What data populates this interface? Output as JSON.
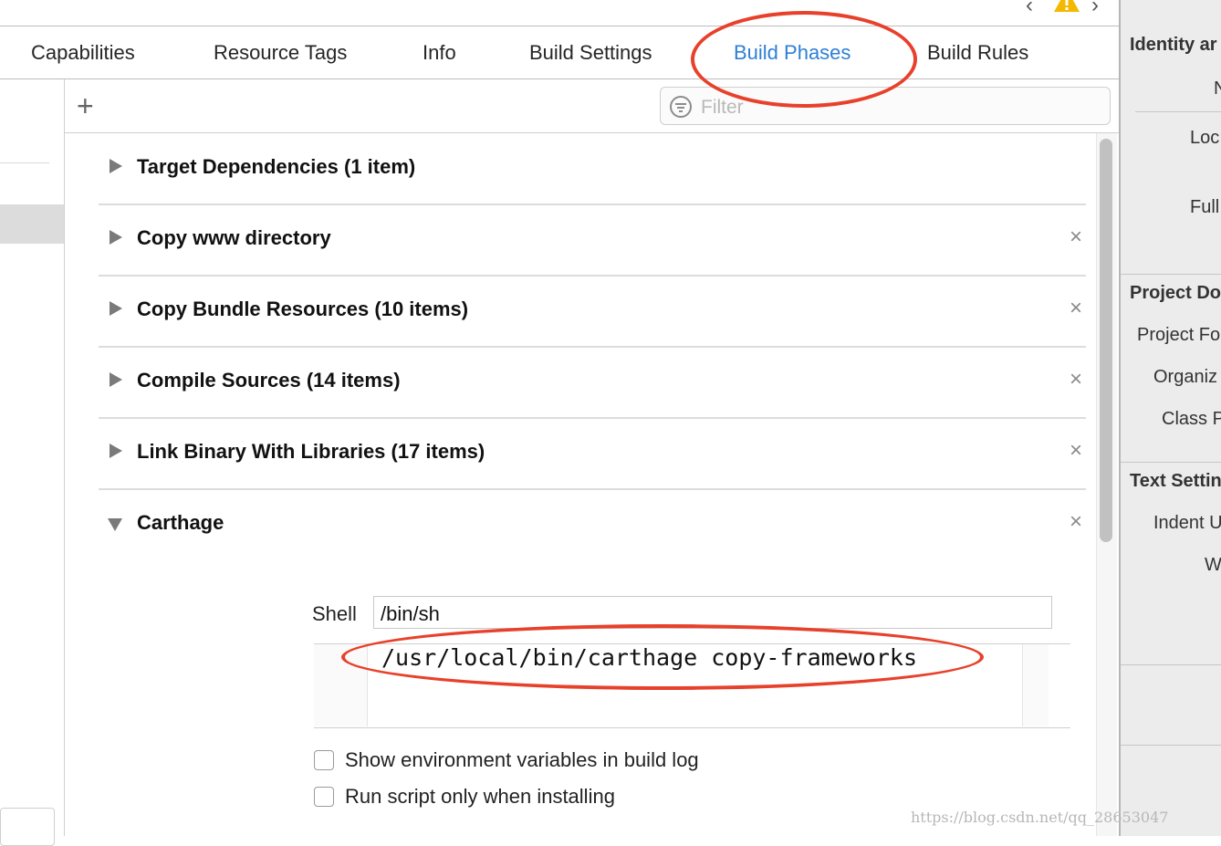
{
  "tabs": [
    {
      "label": "Capabilities"
    },
    {
      "label": "Resource Tags"
    },
    {
      "label": "Info"
    },
    {
      "label": "Build Settings"
    },
    {
      "label": "Build Phases"
    },
    {
      "label": "Build Rules"
    }
  ],
  "active_tab": "Build Phases",
  "filter": {
    "placeholder": "Filter"
  },
  "phases": [
    {
      "title": "Target Dependencies (1 item)",
      "expanded": false,
      "removable": false
    },
    {
      "title": "Copy www directory",
      "expanded": false,
      "removable": true
    },
    {
      "title": "Copy Bundle Resources (10 items)",
      "expanded": false,
      "removable": true
    },
    {
      "title": "Compile Sources (14 items)",
      "expanded": false,
      "removable": true
    },
    {
      "title": "Link Binary With Libraries (17 items)",
      "expanded": false,
      "removable": true
    },
    {
      "title": "Carthage",
      "expanded": true,
      "removable": true
    }
  ],
  "run_script": {
    "shell_label": "Shell",
    "shell_value": "/bin/sh",
    "script": "/usr/local/bin/carthage copy-frameworks",
    "options": [
      {
        "label": "Show environment variables in build log",
        "checked": false
      },
      {
        "label": "Run script only when installing",
        "checked": false
      }
    ]
  },
  "inspector": {
    "sections": [
      {
        "heading": "Identity ar",
        "items": [
          "N",
          "Loc",
          "Full"
        ]
      },
      {
        "heading": "Project Do",
        "items": [
          "Project Fo",
          "Organiz",
          "Class P"
        ]
      },
      {
        "heading": "Text Settin",
        "items": [
          "Indent U",
          "W"
        ]
      }
    ]
  },
  "icons": {
    "close": "×",
    "add": "+",
    "nav_back": "‹",
    "nav_forward": "›"
  },
  "colors": {
    "accent": "#2f7fd4",
    "annotation": "#e8412b",
    "warning": "#f5b800"
  },
  "watermark": "https://blog.csdn.net/qq_28653047"
}
